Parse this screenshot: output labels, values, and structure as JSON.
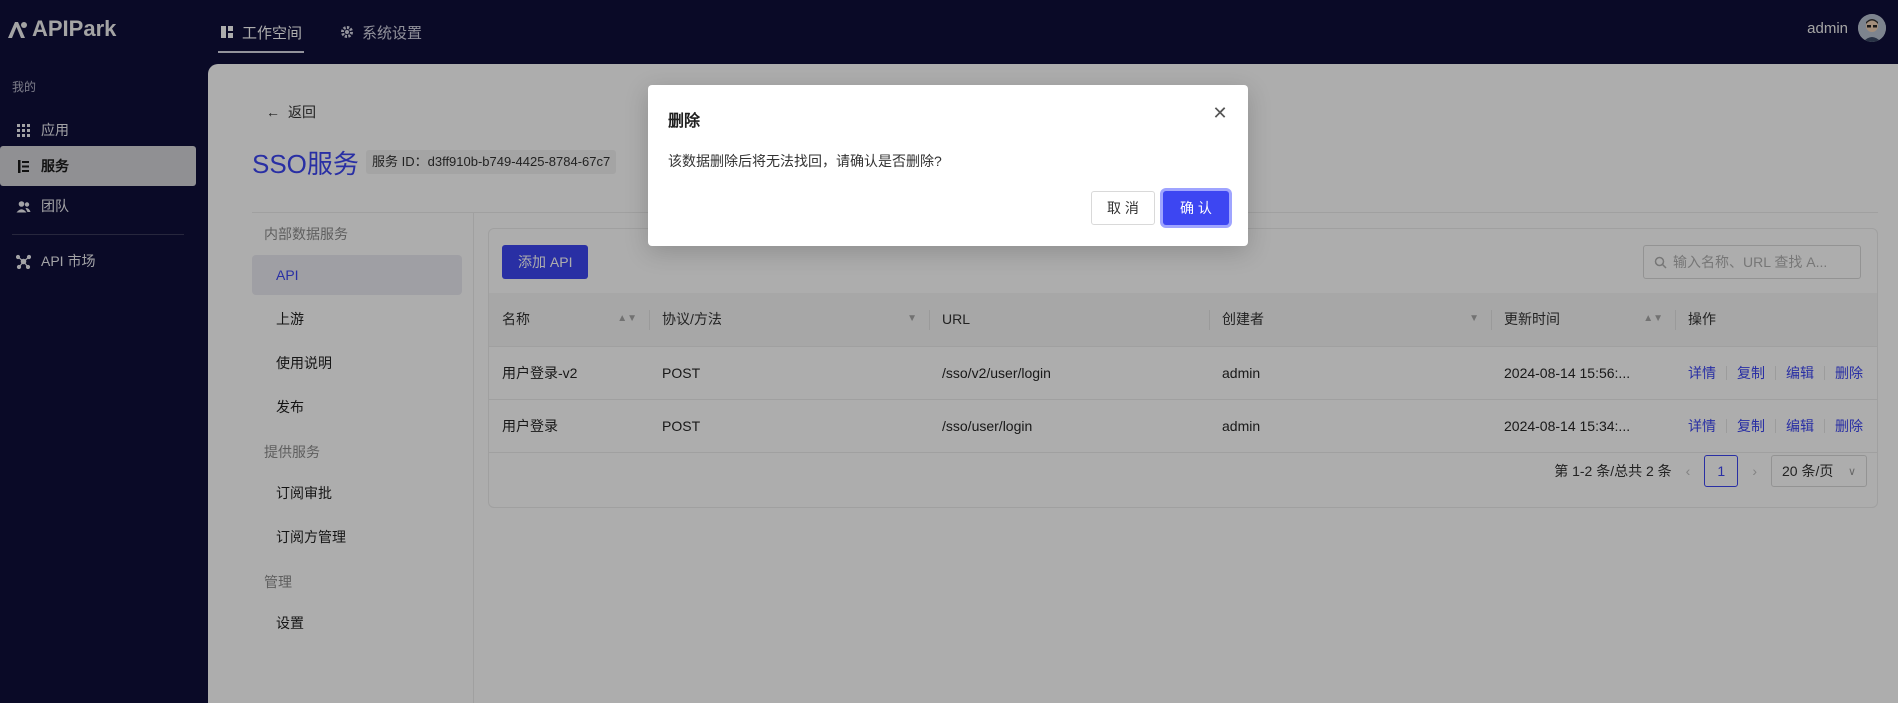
{
  "app": {
    "name": "APIPark"
  },
  "topnav": [
    {
      "label": "工作空间",
      "icon": "dashboard-icon",
      "active": true
    },
    {
      "label": "系统设置",
      "icon": "gear-icon",
      "active": false
    }
  ],
  "user": {
    "name": "admin"
  },
  "sidebar": {
    "group_title": "我的",
    "items": [
      {
        "label": "应用",
        "icon": "grid-icon"
      },
      {
        "label": "服务",
        "icon": "list-icon",
        "active": true
      },
      {
        "label": "团队",
        "icon": "team-icon"
      },
      {
        "label": "API 市场",
        "icon": "network-icon"
      }
    ]
  },
  "header": {
    "back_label": "返回",
    "title": "SSO服务",
    "service_id": "服务 ID：d3ff910b-b749-4425-8784-67c7"
  },
  "subnav": {
    "group1": "内部数据服务",
    "group1_items": [
      "API",
      "上游",
      "使用说明",
      "发布"
    ],
    "group2": "提供服务",
    "group2_items": [
      "订阅审批",
      "订阅方管理"
    ],
    "group3": "管理",
    "group3_items": [
      "设置"
    ]
  },
  "toolbar": {
    "add_label": "添加 API",
    "search_placeholder": "输入名称、URL 查找 A..."
  },
  "table": {
    "headers": [
      "名称",
      "协议/方法",
      "URL",
      "创建者",
      "更新时间",
      "操作"
    ],
    "rows": [
      {
        "name": "用户登录-v2",
        "method": "POST",
        "url": "/sso/v2/user/login",
        "creator": "admin",
        "updated": "2024-08-14 15:56:..."
      },
      {
        "name": "用户登录",
        "method": "POST",
        "url": "/sso/user/login",
        "creator": "admin",
        "updated": "2024-08-14 15:34:..."
      }
    ],
    "row_actions": [
      "详情",
      "复制",
      "编辑",
      "删除"
    ]
  },
  "pagination": {
    "summary": "第 1-2 条/总共 2 条",
    "current_page": "1",
    "page_size": "20 条/页"
  },
  "modal": {
    "title": "删除",
    "message": "该数据删除后将无法找回，请确认是否删除?",
    "cancel_label": "取 消",
    "confirm_label": "确 认"
  },
  "colors": {
    "brand": "#3d46f2",
    "topbar": "#0f0f3a"
  }
}
